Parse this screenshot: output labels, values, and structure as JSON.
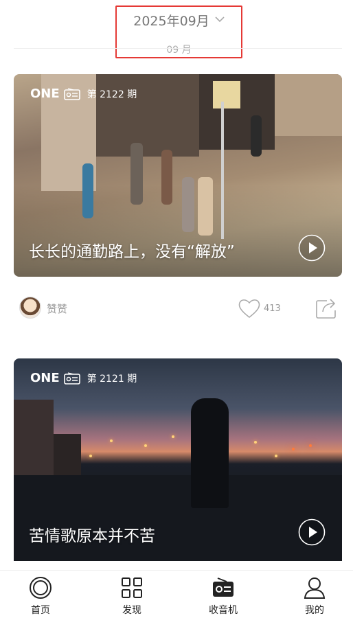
{
  "header": {
    "month_title": "2025年09月",
    "month_sub": "09 月"
  },
  "cards": [
    {
      "logo": "ONE",
      "issue": "第 2122 期",
      "title": "长长的通勤路上，没有“解放”",
      "author": "赞赞",
      "likes": "413"
    },
    {
      "logo": "ONE",
      "issue": "第 2121 期",
      "title": "苦情歌原本并不苦"
    }
  ],
  "tabbar": {
    "items": [
      {
        "label": "首页",
        "icon": "home-icon"
      },
      {
        "label": "发现",
        "icon": "grid-icon"
      },
      {
        "label": "收音机",
        "icon": "radio-icon"
      },
      {
        "label": "我的",
        "icon": "user-icon"
      }
    ]
  },
  "colors": {
    "highlight_border": "#e53935",
    "text_muted": "#999999"
  }
}
